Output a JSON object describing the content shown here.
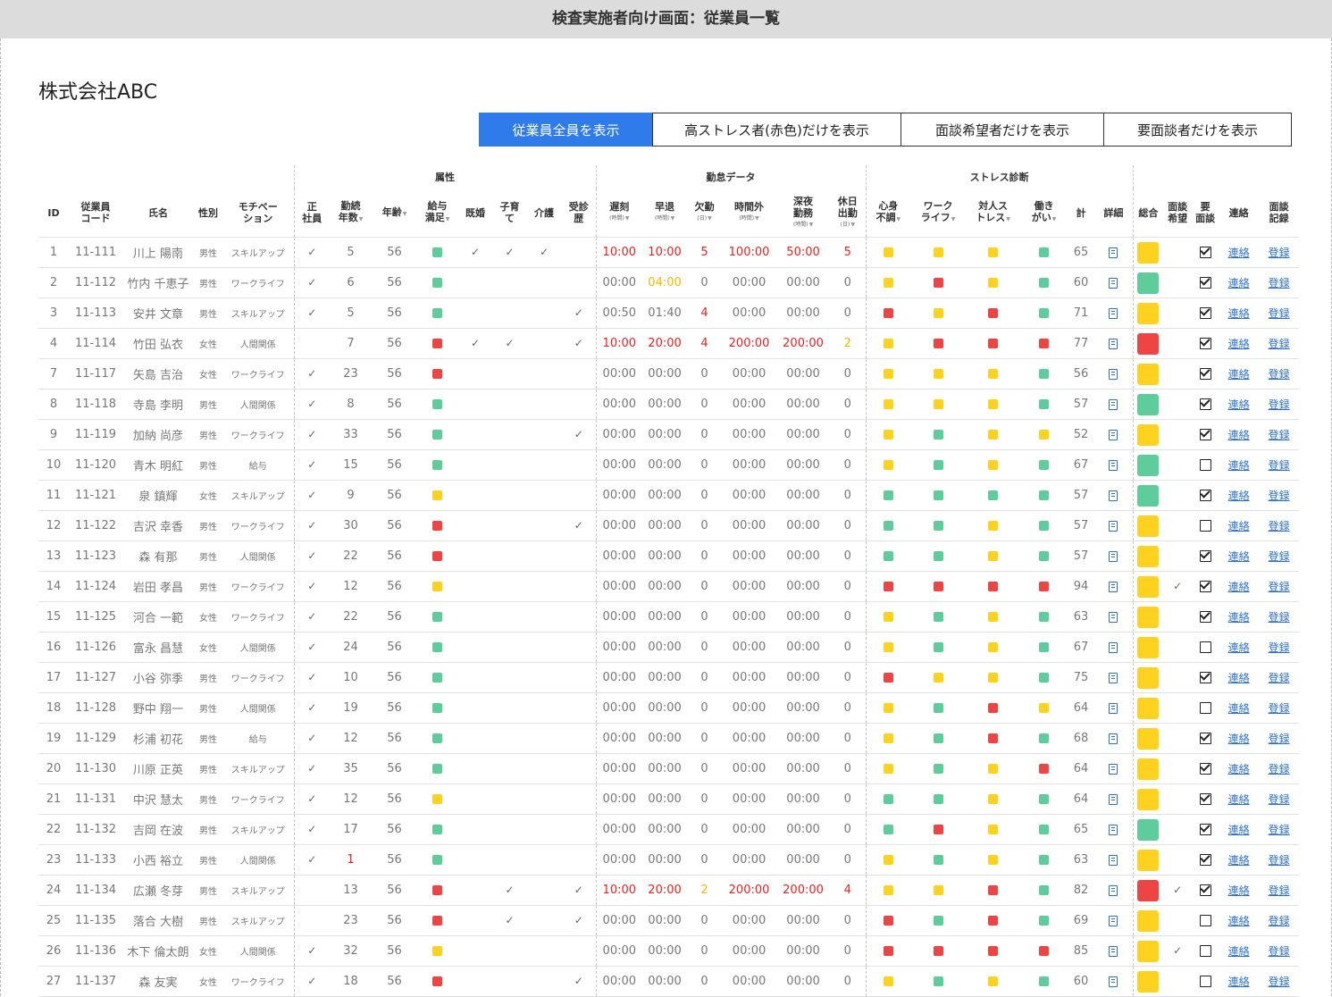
{
  "page_title": "検査実施者向け画面：従業員一覧",
  "company_name": "株式会社ABC",
  "filters": [
    {
      "label": "従業員全員を表示",
      "active": true
    },
    {
      "label": "高ストレス者(赤色)だけを表示",
      "active": false
    },
    {
      "label": "面談希望者だけを表示",
      "active": false
    },
    {
      "label": "要面談者だけを表示",
      "active": false
    }
  ],
  "groups": {
    "attributes": "属性",
    "attendance": "勤怠データ",
    "stress": "ストレス診断"
  },
  "headers": {
    "id": "ID",
    "code": "従業員コード",
    "name": "氏名",
    "gender": "性別",
    "motivation": "モチベーション",
    "regular": "正社員",
    "tenure": "勤続年数",
    "age": "年齢",
    "salary": "給与満足",
    "married": "既婚",
    "childcare": "子育て",
    "care": "介護",
    "consult": "受診歴",
    "late": "遅刻",
    "early": "早退",
    "absent": "欠勤",
    "overtime": "時間外",
    "night": "深夜勤務",
    "holiday": "休日出勤",
    "mind": "心身不調",
    "worklife": "ワークライフ",
    "personal": "対人ストレス",
    "purpose": "働きがい",
    "total": "計",
    "detail": "詳細",
    "overall": "総合",
    "wish": "面談希望",
    "required": "要面談",
    "contact": "連絡",
    "record": "面談記録",
    "unit_hour": "(時間)",
    "unit_day": "(日)"
  },
  "link_labels": {
    "contact": "連絡",
    "record": "登録"
  },
  "colors": {
    "g": "#5fcc9c",
    "y": "#ffd21f",
    "r": "#ef4444",
    "accent": "#2f7bea"
  },
  "rows": [
    {
      "id": "1",
      "code": "11-111",
      "name": "川上 陽南",
      "gender": "男性",
      "motivation": "スキルアップ",
      "regular": true,
      "tenure": "5",
      "age": "56",
      "salary": "g",
      "married": true,
      "child": true,
      "care": true,
      "consult": false,
      "late": "10:00",
      "early": "10:00",
      "absent": "5",
      "overtime": "100:00",
      "night": "50:00",
      "holiday": "5",
      "att": "red",
      "mind": "y",
      "wl": "y",
      "per": "y",
      "pur": "g",
      "total": "65",
      "overall": "y",
      "wish": false,
      "req": true
    },
    {
      "id": "2",
      "code": "11-112",
      "name": "竹内 千恵子",
      "gender": "男性",
      "motivation": "ワークライフ",
      "regular": true,
      "tenure": "6",
      "age": "56",
      "salary": "g",
      "married": false,
      "child": false,
      "care": false,
      "consult": false,
      "late": "00:00",
      "early": "04:00",
      "absent": "0",
      "overtime": "00:00",
      "night": "00:00",
      "holiday": "0",
      "att": "early-org",
      "mind": "y",
      "wl": "r",
      "per": "y",
      "pur": "g",
      "total": "60",
      "overall": "g",
      "wish": false,
      "req": true
    },
    {
      "id": "3",
      "code": "11-113",
      "name": "安井 文章",
      "gender": "男性",
      "motivation": "スキルアップ",
      "regular": true,
      "tenure": "5",
      "age": "56",
      "salary": "g",
      "married": false,
      "child": false,
      "care": false,
      "consult": true,
      "late": "00:50",
      "early": "01:40",
      "absent": "4",
      "overtime": "00:00",
      "night": "00:00",
      "holiday": "0",
      "att": "absent-red",
      "mind": "r",
      "wl": "y",
      "per": "r",
      "pur": "g",
      "total": "71",
      "overall": "y",
      "wish": false,
      "req": true
    },
    {
      "id": "4",
      "code": "11-114",
      "name": "竹田 弘衣",
      "gender": "女性",
      "motivation": "人間関係",
      "regular": false,
      "tenure": "7",
      "age": "56",
      "salary": "r",
      "married": true,
      "child": true,
      "care": false,
      "consult": true,
      "late": "10:00",
      "early": "20:00",
      "absent": "4",
      "overtime": "200:00",
      "night": "200:00",
      "holiday": "2",
      "att": "red-holorg",
      "mind": "y",
      "wl": "r",
      "per": "r",
      "pur": "r",
      "total": "77",
      "overall": "r",
      "wish": false,
      "req": true
    },
    {
      "id": "7",
      "code": "11-117",
      "name": "矢島 吉治",
      "gender": "女性",
      "motivation": "ワークライフ",
      "regular": true,
      "tenure": "23",
      "age": "56",
      "salary": "r",
      "married": false,
      "child": false,
      "care": false,
      "consult": false,
      "late": "00:00",
      "early": "00:00",
      "absent": "0",
      "overtime": "00:00",
      "night": "00:00",
      "holiday": "0",
      "att": "",
      "mind": "y",
      "wl": "y",
      "per": "y",
      "pur": "g",
      "total": "56",
      "overall": "y",
      "wish": false,
      "req": true
    },
    {
      "id": "8",
      "code": "11-118",
      "name": "寺島 李明",
      "gender": "男性",
      "motivation": "人間関係",
      "regular": true,
      "tenure": "8",
      "age": "56",
      "salary": "g",
      "married": false,
      "child": false,
      "care": false,
      "consult": false,
      "late": "00:00",
      "early": "00:00",
      "absent": "0",
      "overtime": "00:00",
      "night": "00:00",
      "holiday": "0",
      "att": "",
      "mind": "y",
      "wl": "y",
      "per": "y",
      "pur": "g",
      "total": "57",
      "overall": "g",
      "wish": false,
      "req": true
    },
    {
      "id": "9",
      "code": "11-119",
      "name": "加納 尚彦",
      "gender": "男性",
      "motivation": "ワークライフ",
      "regular": true,
      "tenure": "33",
      "age": "56",
      "salary": "g",
      "married": false,
      "child": false,
      "care": false,
      "consult": true,
      "late": "00:00",
      "early": "00:00",
      "absent": "0",
      "overtime": "00:00",
      "night": "00:00",
      "holiday": "0",
      "att": "",
      "mind": "y",
      "wl": "g",
      "per": "y",
      "pur": "y",
      "total": "52",
      "overall": "y",
      "wish": false,
      "req": true
    },
    {
      "id": "10",
      "code": "11-120",
      "name": "青木 明紅",
      "gender": "男性",
      "motivation": "給与",
      "regular": true,
      "tenure": "15",
      "age": "56",
      "salary": "g",
      "married": false,
      "child": false,
      "care": false,
      "consult": false,
      "late": "00:00",
      "early": "00:00",
      "absent": "0",
      "overtime": "00:00",
      "night": "00:00",
      "holiday": "0",
      "att": "",
      "mind": "y",
      "wl": "g",
      "per": "y",
      "pur": "g",
      "total": "67",
      "overall": "g",
      "wish": false,
      "req": false
    },
    {
      "id": "11",
      "code": "11-121",
      "name": "泉 鎮輝",
      "gender": "女性",
      "motivation": "スキルアップ",
      "regular": true,
      "tenure": "9",
      "age": "56",
      "salary": "y",
      "married": false,
      "child": false,
      "care": false,
      "consult": false,
      "late": "00:00",
      "early": "00:00",
      "absent": "0",
      "overtime": "00:00",
      "night": "00:00",
      "holiday": "0",
      "att": "",
      "mind": "g",
      "wl": "g",
      "per": "g",
      "pur": "g",
      "total": "57",
      "overall": "g",
      "wish": false,
      "req": true
    },
    {
      "id": "12",
      "code": "11-122",
      "name": "吉沢 幸香",
      "gender": "男性",
      "motivation": "ワークライフ",
      "regular": true,
      "tenure": "30",
      "age": "56",
      "salary": "r",
      "married": false,
      "child": false,
      "care": false,
      "consult": true,
      "late": "00:00",
      "early": "00:00",
      "absent": "0",
      "overtime": "00:00",
      "night": "00:00",
      "holiday": "0",
      "att": "",
      "mind": "g",
      "wl": "g",
      "per": "y",
      "pur": "g",
      "total": "57",
      "overall": "y",
      "wish": false,
      "req": false
    },
    {
      "id": "13",
      "code": "11-123",
      "name": "森 有那",
      "gender": "男性",
      "motivation": "人間関係",
      "regular": true,
      "tenure": "22",
      "age": "56",
      "salary": "r",
      "married": false,
      "child": false,
      "care": false,
      "consult": false,
      "late": "00:00",
      "early": "00:00",
      "absent": "0",
      "overtime": "00:00",
      "night": "00:00",
      "holiday": "0",
      "att": "",
      "mind": "g",
      "wl": "g",
      "per": "y",
      "pur": "g",
      "total": "57",
      "overall": "y",
      "wish": false,
      "req": true
    },
    {
      "id": "14",
      "code": "11-124",
      "name": "岩田 孝昌",
      "gender": "男性",
      "motivation": "ワークライフ",
      "regular": true,
      "tenure": "12",
      "age": "56",
      "salary": "y",
      "married": false,
      "child": false,
      "care": false,
      "consult": false,
      "late": "00:00",
      "early": "00:00",
      "absent": "0",
      "overtime": "00:00",
      "night": "00:00",
      "holiday": "0",
      "att": "",
      "mind": "r",
      "wl": "r",
      "per": "r",
      "pur": "r",
      "total": "94",
      "overall": "y",
      "wish": true,
      "req": true
    },
    {
      "id": "15",
      "code": "11-125",
      "name": "河合 一範",
      "gender": "女性",
      "motivation": "ワークライフ",
      "regular": true,
      "tenure": "22",
      "age": "56",
      "salary": "g",
      "married": false,
      "child": false,
      "care": false,
      "consult": false,
      "late": "00:00",
      "early": "00:00",
      "absent": "0",
      "overtime": "00:00",
      "night": "00:00",
      "holiday": "0",
      "att": "",
      "mind": "y",
      "wl": "g",
      "per": "y",
      "pur": "g",
      "total": "63",
      "overall": "y",
      "wish": false,
      "req": true
    },
    {
      "id": "16",
      "code": "11-126",
      "name": "富永 昌慧",
      "gender": "女性",
      "motivation": "人間関係",
      "regular": true,
      "tenure": "24",
      "age": "56",
      "salary": "g",
      "married": false,
      "child": false,
      "care": false,
      "consult": false,
      "late": "00:00",
      "early": "00:00",
      "absent": "0",
      "overtime": "00:00",
      "night": "00:00",
      "holiday": "0",
      "att": "",
      "mind": "y",
      "wl": "g",
      "per": "y",
      "pur": "g",
      "total": "67",
      "overall": "y",
      "wish": false,
      "req": false
    },
    {
      "id": "17",
      "code": "11-127",
      "name": "小谷 弥季",
      "gender": "男性",
      "motivation": "ワークライフ",
      "regular": true,
      "tenure": "10",
      "age": "56",
      "salary": "g",
      "married": false,
      "child": false,
      "care": false,
      "consult": false,
      "late": "00:00",
      "early": "00:00",
      "absent": "0",
      "overtime": "00:00",
      "night": "00:00",
      "holiday": "0",
      "att": "",
      "mind": "r",
      "wl": "y",
      "per": "y",
      "pur": "g",
      "total": "75",
      "overall": "y",
      "wish": false,
      "req": true
    },
    {
      "id": "18",
      "code": "11-128",
      "name": "野中 翔一",
      "gender": "男性",
      "motivation": "人間関係",
      "regular": true,
      "tenure": "19",
      "age": "56",
      "salary": "g",
      "married": false,
      "child": false,
      "care": false,
      "consult": false,
      "late": "00:00",
      "early": "00:00",
      "absent": "0",
      "overtime": "00:00",
      "night": "00:00",
      "holiday": "0",
      "att": "",
      "mind": "y",
      "wl": "g",
      "per": "r",
      "pur": "y",
      "total": "64",
      "overall": "y",
      "wish": false,
      "req": false
    },
    {
      "id": "19",
      "code": "11-129",
      "name": "杉浦 初花",
      "gender": "男性",
      "motivation": "給与",
      "regular": true,
      "tenure": "12",
      "age": "56",
      "salary": "g",
      "married": false,
      "child": false,
      "care": false,
      "consult": false,
      "late": "00:00",
      "early": "00:00",
      "absent": "0",
      "overtime": "00:00",
      "night": "00:00",
      "holiday": "0",
      "att": "",
      "mind": "y",
      "wl": "g",
      "per": "r",
      "pur": "g",
      "total": "68",
      "overall": "y",
      "wish": false,
      "req": true
    },
    {
      "id": "20",
      "code": "11-130",
      "name": "川原 正英",
      "gender": "男性",
      "motivation": "スキルアップ",
      "regular": true,
      "tenure": "35",
      "age": "56",
      "salary": "g",
      "married": false,
      "child": false,
      "care": false,
      "consult": false,
      "late": "00:00",
      "early": "00:00",
      "absent": "0",
      "overtime": "00:00",
      "night": "00:00",
      "holiday": "0",
      "att": "",
      "mind": "y",
      "wl": "g",
      "per": "y",
      "pur": "r",
      "total": "64",
      "overall": "y",
      "wish": false,
      "req": true
    },
    {
      "id": "21",
      "code": "11-131",
      "name": "中沢 慧太",
      "gender": "男性",
      "motivation": "ワークライフ",
      "regular": true,
      "tenure": "12",
      "age": "56",
      "salary": "y",
      "married": false,
      "child": false,
      "care": false,
      "consult": false,
      "late": "00:00",
      "early": "00:00",
      "absent": "0",
      "overtime": "00:00",
      "night": "00:00",
      "holiday": "0",
      "att": "",
      "mind": "g",
      "wl": "g",
      "per": "y",
      "pur": "g",
      "total": "64",
      "overall": "y",
      "wish": false,
      "req": true
    },
    {
      "id": "22",
      "code": "11-132",
      "name": "吉岡 在波",
      "gender": "男性",
      "motivation": "スキルアップ",
      "regular": true,
      "tenure": "17",
      "age": "56",
      "salary": "g",
      "married": false,
      "child": false,
      "care": false,
      "consult": false,
      "late": "00:00",
      "early": "00:00",
      "absent": "0",
      "overtime": "00:00",
      "night": "00:00",
      "holiday": "0",
      "att": "",
      "mind": "g",
      "wl": "r",
      "per": "y",
      "pur": "g",
      "total": "65",
      "overall": "g",
      "wish": false,
      "req": true
    },
    {
      "id": "23",
      "code": "11-133",
      "name": "小西 裕立",
      "gender": "男性",
      "motivation": "人間関係",
      "regular": true,
      "tenure": "1",
      "age": "56",
      "salary": "g",
      "married": false,
      "child": false,
      "care": false,
      "consult": false,
      "late": "00:00",
      "early": "00:00",
      "absent": "0",
      "overtime": "00:00",
      "night": "00:00",
      "holiday": "0",
      "att": "tenure-red",
      "mind": "y",
      "wl": "g",
      "per": "y",
      "pur": "g",
      "total": "63",
      "overall": "y",
      "wish": false,
      "req": true
    },
    {
      "id": "24",
      "code": "11-134",
      "name": "広瀬 冬芽",
      "gender": "男性",
      "motivation": "スキルアップ",
      "regular": false,
      "tenure": "13",
      "age": "56",
      "salary": "r",
      "married": false,
      "child": true,
      "care": false,
      "consult": true,
      "late": "10:00",
      "early": "20:00",
      "absent": "2",
      "overtime": "200:00",
      "night": "200:00",
      "holiday": "4",
      "att": "red-absorg",
      "mind": "y",
      "wl": "y",
      "per": "r",
      "pur": "g",
      "total": "82",
      "overall": "r",
      "wish": true,
      "req": true
    },
    {
      "id": "25",
      "code": "11-135",
      "name": "落合 大樹",
      "gender": "男性",
      "motivation": "スキルアップ",
      "regular": false,
      "tenure": "23",
      "age": "56",
      "salary": "r",
      "married": false,
      "child": true,
      "care": false,
      "consult": true,
      "late": "00:00",
      "early": "00:00",
      "absent": "0",
      "overtime": "00:00",
      "night": "00:00",
      "holiday": "0",
      "att": "",
      "mind": "r",
      "wl": "g",
      "per": "r",
      "pur": "g",
      "total": "69",
      "overall": "y",
      "wish": false,
      "req": false
    },
    {
      "id": "26",
      "code": "11-136",
      "name": "木下 倫太朗",
      "gender": "女性",
      "motivation": "人間関係",
      "regular": true,
      "tenure": "32",
      "age": "56",
      "salary": "y",
      "married": false,
      "child": false,
      "care": false,
      "consult": false,
      "late": "00:00",
      "early": "00:00",
      "absent": "0",
      "overtime": "00:00",
      "night": "00:00",
      "holiday": "0",
      "att": "",
      "mind": "r",
      "wl": "r",
      "per": "r",
      "pur": "r",
      "total": "85",
      "overall": "y",
      "wish": true,
      "req": false
    },
    {
      "id": "27",
      "code": "11-137",
      "name": "森 友実",
      "gender": "女性",
      "motivation": "ワークライフ",
      "regular": true,
      "tenure": "18",
      "age": "56",
      "salary": "r",
      "married": false,
      "child": false,
      "care": false,
      "consult": true,
      "late": "00:00",
      "early": "00:00",
      "absent": "0",
      "overtime": "00:00",
      "night": "00:00",
      "holiday": "0",
      "att": "",
      "mind": "y",
      "wl": "g",
      "per": "y",
      "pur": "g",
      "total": "60",
      "overall": "y",
      "wish": false,
      "req": false
    }
  ]
}
